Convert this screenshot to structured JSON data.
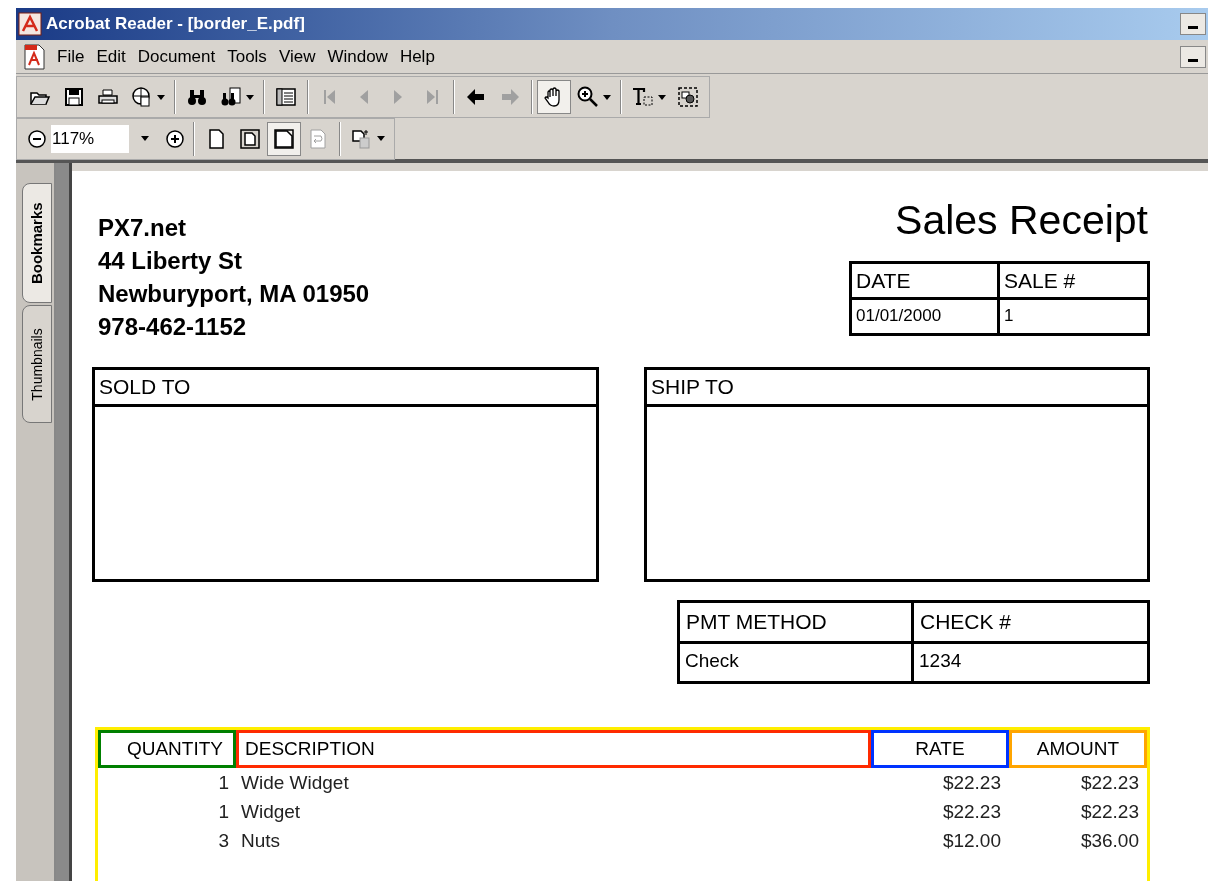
{
  "window": {
    "title": "Acrobat Reader - [border_E.pdf]"
  },
  "menu": [
    {
      "label": "File"
    },
    {
      "label": "Edit"
    },
    {
      "label": "Document"
    },
    {
      "label": "Tools"
    },
    {
      "label": "View"
    },
    {
      "label": "Window"
    },
    {
      "label": "Help"
    }
  ],
  "toolbar_1": [
    {
      "kind": "open",
      "selected": false,
      "disabled": false
    },
    {
      "kind": "save",
      "selected": false,
      "disabled": false
    },
    {
      "kind": "print",
      "selected": false,
      "disabled": false
    },
    {
      "kind": "globe",
      "selected": false,
      "disabled": false,
      "dropdown": true
    },
    {
      "kind": "separator"
    },
    {
      "kind": "binoculars",
      "selected": false,
      "disabled": false
    },
    {
      "kind": "search",
      "selected": false,
      "disabled": false,
      "dropdown": true
    },
    {
      "kind": "separator"
    },
    {
      "kind": "panel",
      "selected": false,
      "disabled": false
    },
    {
      "kind": "separator"
    },
    {
      "kind": "first",
      "selected": false,
      "disabled": true
    },
    {
      "kind": "prev",
      "selected": false,
      "disabled": true
    },
    {
      "kind": "next",
      "selected": false,
      "disabled": true
    },
    {
      "kind": "last",
      "selected": false,
      "disabled": true
    },
    {
      "kind": "separator"
    },
    {
      "kind": "back",
      "selected": false,
      "disabled": false
    },
    {
      "kind": "forward",
      "selected": false,
      "disabled": true
    },
    {
      "kind": "separator"
    },
    {
      "kind": "hand",
      "selected": true,
      "disabled": false
    },
    {
      "kind": "zoom",
      "selected": false,
      "disabled": false,
      "dropdown": true
    },
    {
      "kind": "separator"
    },
    {
      "kind": "text",
      "selected": false,
      "disabled": false,
      "dropdown": true
    },
    {
      "kind": "snapshot",
      "selected": false,
      "disabled": false
    }
  ],
  "zoom_field": {
    "value": "117%"
  },
  "toolbar_2": [
    {
      "kind": "page",
      "selected": false,
      "disabled": false
    },
    {
      "kind": "fitpage",
      "selected": false,
      "disabled": false
    },
    {
      "kind": "fitwidth",
      "selected": true,
      "disabled": false
    },
    {
      "kind": "reflow",
      "selected": false,
      "disabled": true
    },
    {
      "kind": "separator"
    },
    {
      "kind": "rotate",
      "selected": false,
      "disabled": false,
      "dropdown": true
    }
  ],
  "side_tabs": [
    {
      "label": "Bookmarks",
      "selected": true
    },
    {
      "label": "Thumbnails",
      "selected": false
    }
  ],
  "document": {
    "company_lines": [
      "PX7.net",
      "44 Liberty St",
      "Newburyport, MA 01950",
      "978-462-1152"
    ],
    "title": "Sales Receipt",
    "info_table": {
      "columns": [
        "DATE",
        "SALE #"
      ],
      "values": [
        "01/01/2000",
        "1"
      ]
    },
    "sold_to": {
      "label": "SOLD TO"
    },
    "ship_to": {
      "label": "SHIP TO"
    },
    "payment_table": {
      "columns": [
        "PMT METHOD",
        "CHECK #"
      ],
      "values": [
        "Check",
        "1234"
      ]
    },
    "items": {
      "columns": [
        {
          "label": "QUANTITY",
          "color": "#008000"
        },
        {
          "label": "DESCRIPTION",
          "color": "#ff2a00"
        },
        {
          "label": "RATE",
          "color": "#0033ff"
        },
        {
          "label": "AMOUNT",
          "color": "#ffa500"
        }
      ],
      "rows": [
        {
          "quantity": "1",
          "description": "Wide Widget",
          "rate": "$22.23",
          "amount": "$22.23"
        },
        {
          "quantity": "1",
          "description": "Widget",
          "rate": "$22.23",
          "amount": "$22.23"
        },
        {
          "quantity": "3",
          "description": "Nuts",
          "rate": "$12.00",
          "amount": "$36.00"
        }
      ]
    }
  }
}
